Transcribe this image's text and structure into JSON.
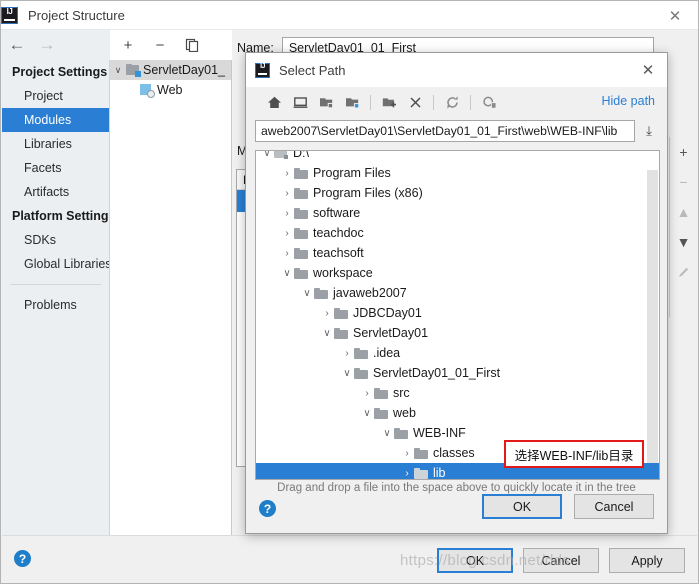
{
  "window": {
    "title": "Project Structure",
    "logo_text": "IJ",
    "close_label": "✕",
    "nav_back": "←",
    "nav_forward": "→"
  },
  "sidebar": {
    "groups": [
      {
        "header": "Project Settings",
        "items": [
          {
            "label": "Project",
            "selected": false
          },
          {
            "label": "Modules",
            "selected": true
          },
          {
            "label": "Libraries",
            "selected": false
          },
          {
            "label": "Facets",
            "selected": false
          },
          {
            "label": "Artifacts",
            "selected": false
          }
        ]
      },
      {
        "header": "Platform Settings",
        "items": [
          {
            "label": "SDKs",
            "selected": false
          },
          {
            "label": "Global Libraries",
            "selected": false
          }
        ]
      }
    ],
    "problems": "Problems"
  },
  "module_toolbar": {
    "add": "+",
    "remove": "−",
    "copy": "copy-icon"
  },
  "module_tree": {
    "rows": [
      {
        "label": "ServletDay01_",
        "twisty": "∨",
        "icon": "module-folder-icon",
        "indent": 0,
        "selected": true
      },
      {
        "label": "Web",
        "twisty": "",
        "icon": "web-facet-icon",
        "indent": 1,
        "selected": false
      }
    ]
  },
  "content": {
    "name_label": "Name:",
    "name_value": "ServletDay01_01_First",
    "module_sdk_label": "M",
    "dependencies_label": "D",
    "column_header": "E"
  },
  "right_toolbar": {
    "add": "+",
    "remove": "−",
    "move_up": "▲",
    "move_down": "▼",
    "edit": "edit-pencil-icon"
  },
  "main_footer": {
    "help": "?",
    "ok": "OK",
    "cancel": "Cancel",
    "apply": "Apply"
  },
  "select_path_dialog": {
    "title": "Select Path",
    "logo_text": "IJ",
    "close_label": "✕",
    "toolbar": [
      {
        "name": "home-icon",
        "tip": "Home"
      },
      {
        "name": "desktop-icon",
        "tip": "Desktop"
      },
      {
        "name": "project-folder-icon",
        "tip": "Project"
      },
      {
        "name": "module-folder-icon",
        "tip": "Module"
      },
      {
        "name": "new-folder-icon",
        "tip": "New Folder"
      },
      {
        "name": "delete-icon",
        "tip": "Delete"
      },
      {
        "name": "refresh-icon",
        "tip": "Refresh"
      },
      {
        "name": "show-hidden-icon",
        "tip": "Show Hidden Files"
      }
    ],
    "hide_path": "Hide path",
    "path_value": "aweb2007\\ServletDay01\\ServletDay01_01_First\\web\\WEB-INF\\lib",
    "path_download_icon": "⤓",
    "tree": [
      {
        "label": "D:\\",
        "indent": 0,
        "twisty": "∨",
        "icon": "drive-icon",
        "selected": false
      },
      {
        "label": "Program Files",
        "indent": 1,
        "twisty": "›",
        "icon": "folder-icon",
        "selected": false
      },
      {
        "label": "Program Files (x86)",
        "indent": 1,
        "twisty": "›",
        "icon": "folder-icon",
        "selected": false
      },
      {
        "label": "software",
        "indent": 1,
        "twisty": "›",
        "icon": "folder-icon",
        "selected": false
      },
      {
        "label": "teachdoc",
        "indent": 1,
        "twisty": "›",
        "icon": "folder-icon",
        "selected": false
      },
      {
        "label": "teachsoft",
        "indent": 1,
        "twisty": "›",
        "icon": "folder-icon",
        "selected": false
      },
      {
        "label": "workspace",
        "indent": 1,
        "twisty": "∨",
        "icon": "folder-icon",
        "selected": false
      },
      {
        "label": "javaweb2007",
        "indent": 2,
        "twisty": "∨",
        "icon": "folder-icon",
        "selected": false
      },
      {
        "label": "JDBCDay01",
        "indent": 3,
        "twisty": "›",
        "icon": "folder-icon",
        "selected": false
      },
      {
        "label": "ServletDay01",
        "indent": 3,
        "twisty": "∨",
        "icon": "folder-icon",
        "selected": false
      },
      {
        "label": ".idea",
        "indent": 4,
        "twisty": "›",
        "icon": "folder-icon",
        "selected": false
      },
      {
        "label": "ServletDay01_01_First",
        "indent": 4,
        "twisty": "∨",
        "icon": "folder-icon",
        "selected": false
      },
      {
        "label": "src",
        "indent": 5,
        "twisty": "›",
        "icon": "folder-icon",
        "selected": false
      },
      {
        "label": "web",
        "indent": 5,
        "twisty": "∨",
        "icon": "folder-icon",
        "selected": false
      },
      {
        "label": "WEB-INF",
        "indent": 6,
        "twisty": "∨",
        "icon": "folder-icon",
        "selected": false
      },
      {
        "label": "classes",
        "indent": 7,
        "twisty": "›",
        "icon": "folder-icon",
        "selected": false
      },
      {
        "label": "lib",
        "indent": 7,
        "twisty": "›",
        "icon": "folder-icon",
        "selected": true
      }
    ],
    "dnd_hint": "Drag and drop a file into the space above to quickly locate it in the tree",
    "help": "?",
    "ok": "OK",
    "cancel": "Cancel"
  },
  "annotation": {
    "text": "选择WEB-INF/lib目录",
    "border_color": "#e31818"
  },
  "watermark": {
    "text": "https://blog.csdn.net/dds"
  },
  "colors": {
    "accent": "#2a7fd4",
    "selection": "#2a7fd4",
    "link": "#2a7fd4",
    "annotation_red": "#e31818",
    "sidebar_bg": "#ebeff2"
  }
}
